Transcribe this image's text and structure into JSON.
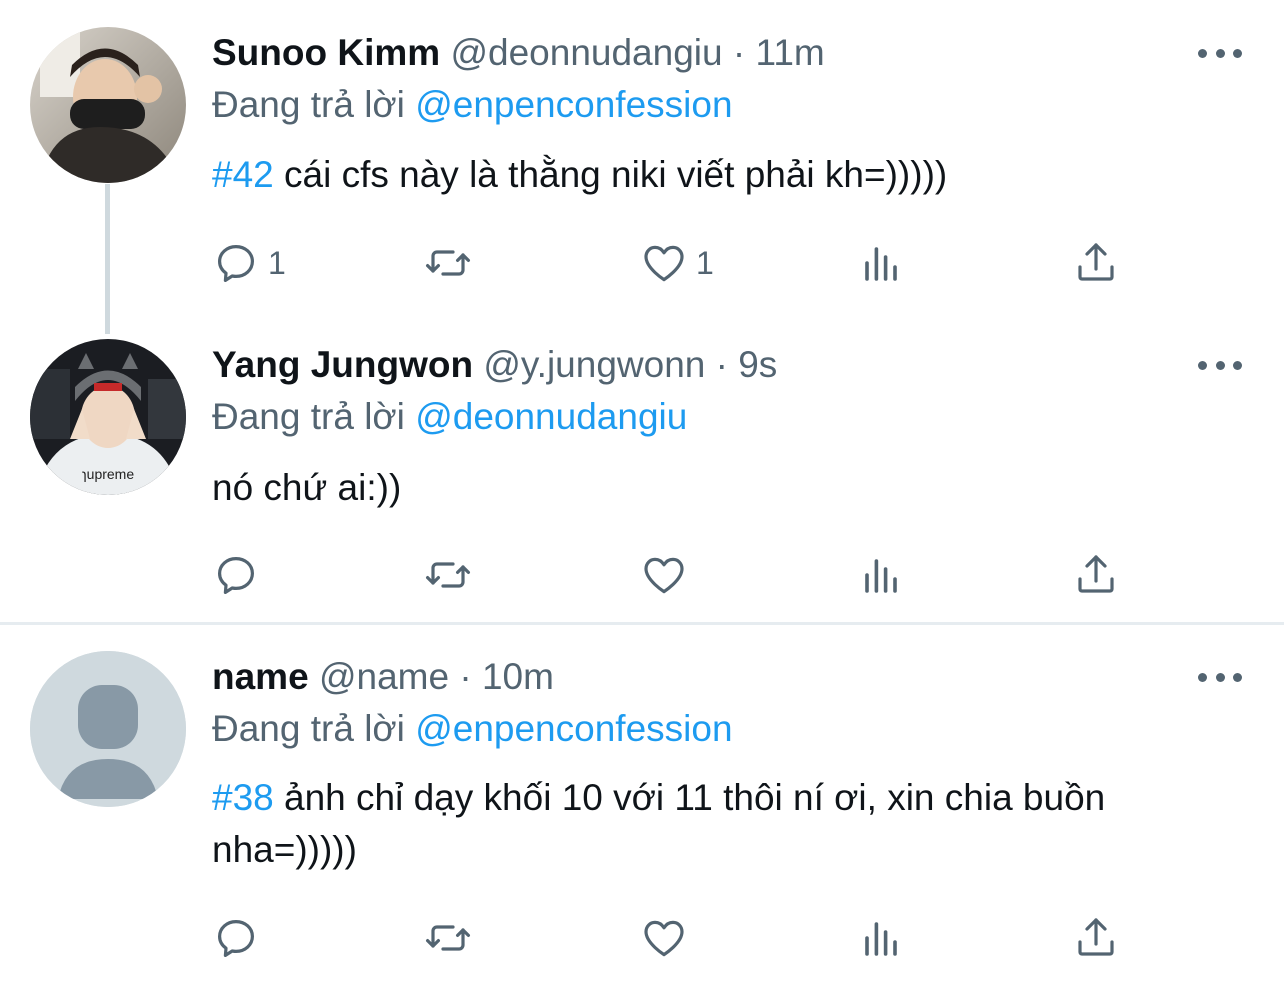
{
  "tweets": [
    {
      "display_name": "Sunoo Kimm",
      "handle": "@deonnudangiu",
      "separator": "·",
      "time": "11m",
      "reply_prefix": "Đang trả lời",
      "reply_to": "@enpenconfession",
      "hashtag": "#42",
      "text": "cái cfs này là thằng niki viết phải kh=)))))",
      "reply_count": "1",
      "retweet_count": "",
      "like_count": "1"
    },
    {
      "display_name": "Yang Jungwon",
      "handle": "@y.jungwonn",
      "separator": "·",
      "time": "9s",
      "reply_prefix": "Đang trả lời",
      "reply_to": "@deonnudangiu",
      "hashtag": "",
      "text": "nó chứ ai:))",
      "reply_count": "",
      "retweet_count": "",
      "like_count": ""
    },
    {
      "display_name": "name",
      "handle": "@name",
      "separator": "·",
      "time": "10m",
      "reply_prefix": "Đang trả lời",
      "reply_to": "@enpenconfession",
      "hashtag": "#38",
      "text": "ảnh chỉ dạy khối 10 với 11 thôi ní ơi, xin chia buồn nha=)))))",
      "reply_count": "",
      "retweet_count": "",
      "like_count": ""
    }
  ],
  "icons": {
    "reply": "reply-icon",
    "retweet": "retweet-icon",
    "like": "heart-icon",
    "views": "analytics-icon",
    "share": "share-icon",
    "more": "more-icon"
  },
  "colors": {
    "link": "#1d9bf0",
    "secondary_text": "#536471",
    "primary_text": "#0f1419",
    "default_avatar_bg": "#cfd9de",
    "default_avatar_fg": "#8899a6"
  }
}
